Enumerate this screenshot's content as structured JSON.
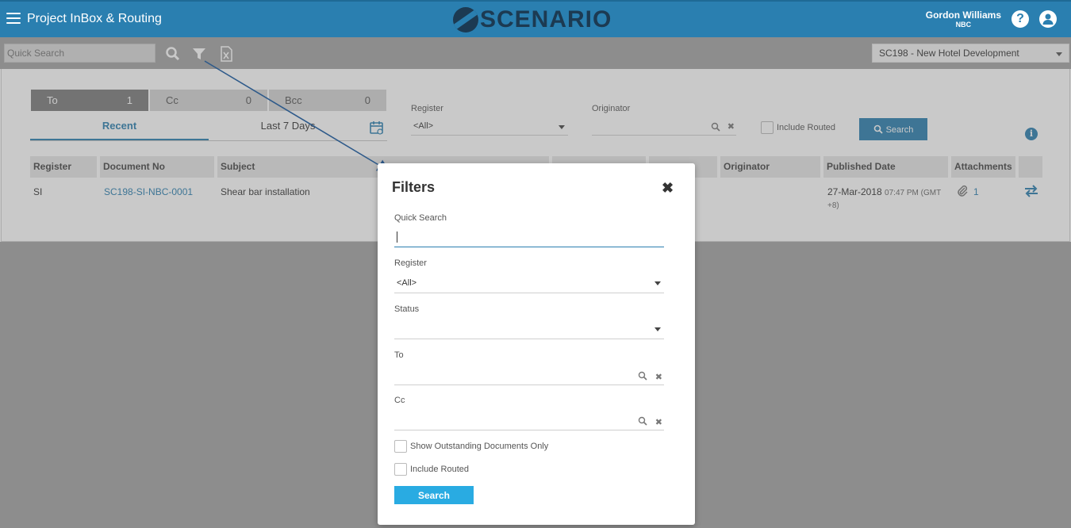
{
  "header": {
    "app_title": "Project InBox & Routing",
    "logo_text": "SCENARIO",
    "user_name": "Gordon Williams",
    "user_org": "NBC",
    "help_glyph": "?"
  },
  "toolbar": {
    "quick_search_placeholder": "Quick Search",
    "project_selected": "SC198 - New Hotel Development"
  },
  "recipient_tabs": [
    {
      "label": "To",
      "count": "1"
    },
    {
      "label": "Cc",
      "count": "0"
    },
    {
      "label": "Bcc",
      "count": "0"
    }
  ],
  "period_tabs": [
    "Recent",
    "Last 7 Days"
  ],
  "filters": {
    "register_label": "Register",
    "register_value": "<All>",
    "originator_label": "Originator",
    "include_routed_label": "Include Routed",
    "search_label": "Search"
  },
  "table": {
    "columns": [
      "Register",
      "Document No",
      "Subject",
      "Originator",
      "Published Date",
      "Attachments"
    ],
    "rows": [
      {
        "register": "SI",
        "document_no": "SC198-SI-NBC-0001",
        "subject": "Shear bar installation",
        "published_date": "27-Mar-2018",
        "published_time": "07:47 PM (GMT",
        "published_tz": "+8)",
        "attachments": "1"
      }
    ]
  },
  "modal": {
    "title": "Filters",
    "close_glyph": "✖",
    "quick_search_label": "Quick Search",
    "quick_search_value": "",
    "register_label": "Register",
    "register_value": "<All>",
    "status_label": "Status",
    "status_value": "",
    "to_label": "To",
    "cc_label": "Cc",
    "outstanding_label": "Show Outstanding Documents Only",
    "include_routed_label": "Include Routed",
    "search_label": "Search"
  },
  "colors": {
    "header_blue": "#2a7fb0",
    "modal_search_button": "#29abe2",
    "logo_dark": "#1c3a52"
  },
  "icons": [
    "hamburger-icon",
    "help-icon",
    "user-icon",
    "search-icon",
    "filter-icon",
    "excel-export-icon",
    "calendar-icon",
    "info-icon",
    "paperclip-icon",
    "route-icon",
    "close-icon",
    "clear-icon"
  ]
}
